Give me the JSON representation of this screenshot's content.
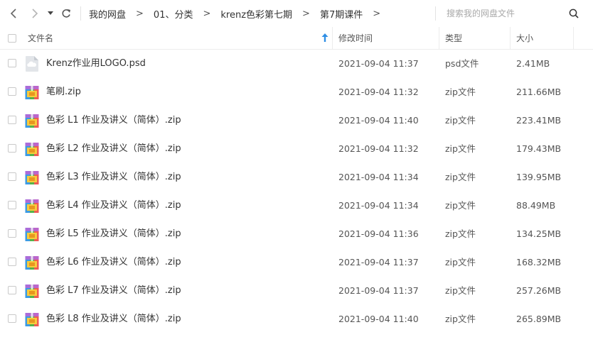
{
  "toolbar": {
    "back_icon": "chevron-left-icon",
    "forward_icon": "chevron-right-icon",
    "dropdown_icon": "caret-down-icon",
    "refresh_icon": "refresh-icon",
    "breadcrumb": [
      "我的网盘",
      "01、分类",
      "krenz色彩第七期",
      "第7期课件"
    ],
    "separator": ">",
    "search_placeholder": "搜索我的网盘文件",
    "search_icon": "search-icon"
  },
  "columns": {
    "name": "文件名",
    "modified": "修改时间",
    "type": "类型",
    "size": "大小",
    "sort_indicator": "sort-ascending-icon"
  },
  "colors": {
    "sort_arrow": "#2f8fe5",
    "border": "#ececec",
    "text": "#333333",
    "muted": "#555555"
  },
  "files": [
    {
      "name": "Krenz作业用LOGO.psd",
      "modified": "2021-09-04 11:37",
      "type": "psd文件",
      "size": "2.41MB",
      "icon": "psd-file-icon"
    },
    {
      "name": "笔刷.zip",
      "modified": "2021-09-04 11:32",
      "type": "zip文件",
      "size": "211.66MB",
      "icon": "zip-file-icon"
    },
    {
      "name": "色彩 L1 作业及讲义（简体）.zip",
      "modified": "2021-09-04 11:40",
      "type": "zip文件",
      "size": "223.41MB",
      "icon": "zip-file-icon"
    },
    {
      "name": "色彩 L2 作业及讲义（简体）.zip",
      "modified": "2021-09-04 11:32",
      "type": "zip文件",
      "size": "179.43MB",
      "icon": "zip-file-icon"
    },
    {
      "name": "色彩 L3 作业及讲义（简体）.zip",
      "modified": "2021-09-04 11:34",
      "type": "zip文件",
      "size": "139.95MB",
      "icon": "zip-file-icon"
    },
    {
      "name": "色彩 L4 作业及讲义（简体）.zip",
      "modified": "2021-09-04 11:34",
      "type": "zip文件",
      "size": "88.49MB",
      "icon": "zip-file-icon"
    },
    {
      "name": "色彩 L5 作业及讲义（简体）.zip",
      "modified": "2021-09-04 11:36",
      "type": "zip文件",
      "size": "134.25MB",
      "icon": "zip-file-icon"
    },
    {
      "name": "色彩 L6 作业及讲义（简体）.zip",
      "modified": "2021-09-04 11:37",
      "type": "zip文件",
      "size": "168.32MB",
      "icon": "zip-file-icon"
    },
    {
      "name": "色彩 L7 作业及讲义（简体）.zip",
      "modified": "2021-09-04 11:37",
      "type": "zip文件",
      "size": "257.26MB",
      "icon": "zip-file-icon"
    },
    {
      "name": "色彩 L8 作业及讲义（简体）.zip",
      "modified": "2021-09-04 11:40",
      "type": "zip文件",
      "size": "265.89MB",
      "icon": "zip-file-icon"
    }
  ]
}
